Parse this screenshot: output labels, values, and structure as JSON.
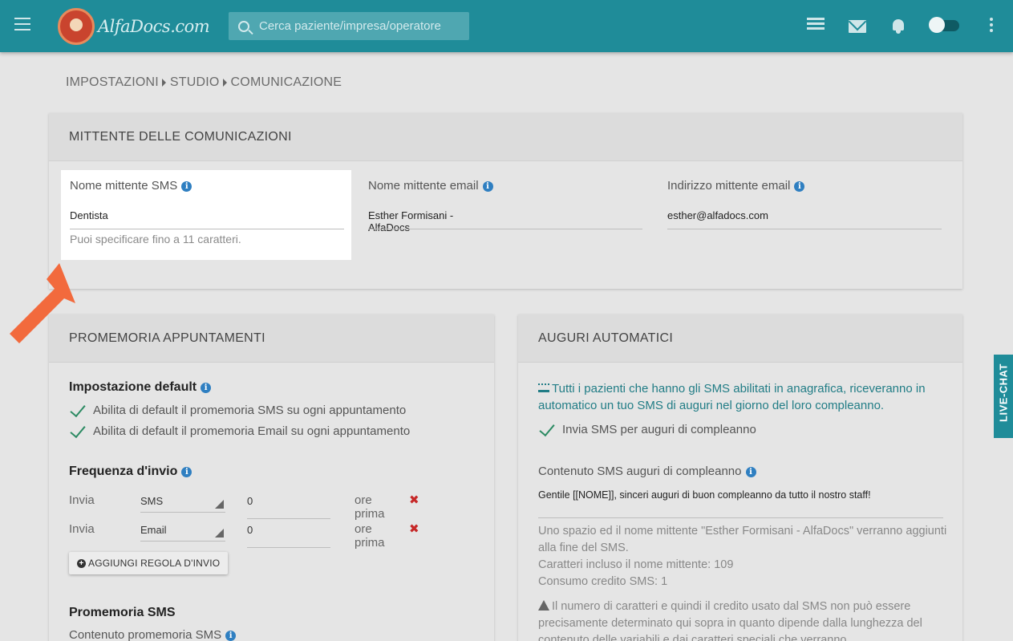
{
  "header": {
    "brand": "AlfaDocs.com",
    "search_placeholder": "Cerca paziente/impresa/operatore"
  },
  "breadcrumb": [
    "IMPOSTAZIONI",
    "STUDIO",
    "COMUNICAZIONE"
  ],
  "sender": {
    "title": "MITTENTE DELLE COMUNICAZIONI",
    "sms_label": "Nome mittente SMS",
    "sms_value": "Dentista",
    "sms_hint": "Puoi specificare fino a 11 caratteri.",
    "email_name_label": "Nome mittente email",
    "email_name_value": "Esther Formisani - AlfaDocs",
    "email_addr_label": "Indirizzo mittente email",
    "email_addr_value": "esther@alfadocs.com"
  },
  "reminders": {
    "title": "PROMEMORIA APPUNTAMENTI",
    "default_title": "Impostazione default",
    "default_sms": "Abilita di default il promemoria SMS su ogni appuntamento",
    "default_email": "Abilita di default il promemoria Email su ogni appuntamento",
    "frequency_title": "Frequenza d'invio",
    "rules": [
      {
        "label": "Invia",
        "channel": "SMS",
        "hours": "0",
        "after": "ore prima"
      },
      {
        "label": "Invia",
        "channel": "Email",
        "hours": "0",
        "after": "ore prima"
      }
    ],
    "add_rule": "AGGIUNGI REGOLA D'INVIO",
    "sms_title": "Promemoria SMS",
    "sms_content_label": "Contenuto promemoria SMS"
  },
  "birthday": {
    "title": "AUGURI AUTOMATICI",
    "intro": "Tutti i pazienti che hanno gli SMS abilitati in anagrafica, riceveranno in automatico un tuo SMS di auguri nel giorno del loro compleanno.",
    "send_label": "Invia SMS per auguri di compleanno",
    "content_label": "Contenuto SMS auguri di compleanno",
    "content_value": "Gentile [[NOME]], sinceri auguri di buon compleanno da tutto il nostro staff!",
    "info_1": "Uno spazio ed il nome mittente \"Esther Formisani - AlfaDocs\" verranno aggiunti alla fine del SMS.",
    "info_2": "Caratteri incluso il nome mittente: 109",
    "info_3": "Consumo credito SMS: 1",
    "warning": "Il numero di caratteri e quindi il credito usato dal SMS non può essere precisamente determinato qui sopra in quanto dipende dalla lunghezza del contenuto delle variabili e dai caratteri speciali che verranno"
  },
  "livechat": "LIVE-CHAT",
  "colors": {
    "topbar": "#1f8c99",
    "accent_text": "#227d86",
    "check": "#2b8a62",
    "delete": "#c62828",
    "arrow": "#f26a3d"
  }
}
